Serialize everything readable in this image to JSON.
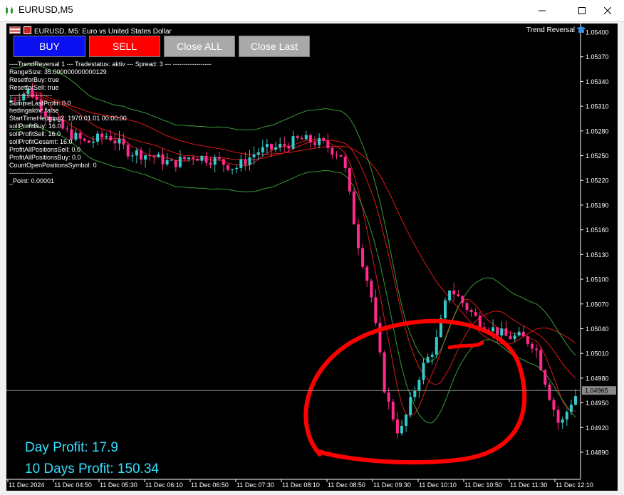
{
  "window": {
    "title": "EURUSD,M5",
    "minimize_icon": "minimize-icon",
    "maximize_icon": "maximize-icon",
    "close_icon": "close-icon"
  },
  "chart": {
    "header": "EURUSD, M5:  Euro vs United States Dollar",
    "ea_name": "Trend Reversal",
    "current_price": "1.04965",
    "price_labels": [
      "1.05400",
      "1.05370",
      "1.05340",
      "1.05310",
      "1.05280",
      "1.05250",
      "1.05220",
      "1.05190",
      "1.05160",
      "1.05130",
      "1.05100",
      "1.05070",
      "1.05040",
      "1.05010",
      "1.04980",
      "1.04950",
      "1.04920",
      "1.04890"
    ],
    "time_labels": [
      "11 Dec 2024",
      "11 Dec 04:50",
      "11 Dec 05:30",
      "11 Dec 06:10",
      "11 Dec 06:50",
      "11 Dec 07:30",
      "11 Dec 08:10",
      "11 Dec 08:50",
      "11 Dec 09:30",
      "11 Dec 10:10",
      "11 Dec 10:50",
      "11 Dec 11:30",
      "11 Dec 12:10"
    ],
    "colors": {
      "bull": "#36c9c9",
      "bear": "#ff2a8a",
      "ma": "#e01818",
      "bands": "#3a9a3a",
      "annotation": "#ff0000",
      "profit": "#33e0ff"
    }
  },
  "buttons": {
    "buy": "BUY",
    "sell": "SELL",
    "close_all": "Close ALL",
    "close_last": "Close Last"
  },
  "info_lines": [
    "----TrendReversal 1 --- Tradestatus: aktiv --- Spread: 3 --- ------------------",
    "RangeSize: 35.000000000000129",
    "ResetforBuy: true",
    "ResetforSell: true",
    "--------------------",
    "SummeLastProfit: 0.0",
    "hedingaktiv: false",
    "StartTimeHedging2: 1970.01.01 00:00:00",
    "sollProfitBuy: 16.0",
    "sollProfitSell: 16.0",
    "sollProfitGesamt: 16.0",
    "ProfitAllPositionsSell: 0.0",
    "ProfitAllPositionsBuy: 0.0",
    "CountOpenPositionsSymbol: 0",
    "--------------------",
    "_Point: 0.00001"
  ],
  "profit": {
    "day": "Day Profit: 17.9",
    "ten_days": "10 Days Profit: 150.34"
  }
}
